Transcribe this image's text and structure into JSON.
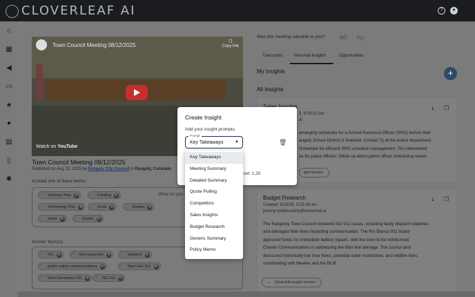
{
  "app": {
    "logo_text": "CLOVERLEAF AI"
  },
  "topbar": {
    "help_icon": "help-circle-icon",
    "account_icon": "account-circle-icon"
  },
  "sidebar": {
    "icons": [
      "home-icon",
      "dashboard-icon",
      "megaphone-icon",
      "chat-icon",
      "star-icon",
      "person-icon",
      "document-icon",
      "file-icon",
      "settings-shield-icon"
    ]
  },
  "video": {
    "overlay_title": "Town Council Meeting 08/12/2025",
    "copy_link": "Copy link",
    "watch_on": "Watch on",
    "youtube": "YouTube"
  },
  "meeting": {
    "title": "Town Council Meeting 08/12/2025",
    "published_prefix": "Published on Aug 13, 2025 by",
    "publisher": "Rangely City Council",
    "location_prefix": "in",
    "location": "Rangely, Colorado"
  },
  "terms": {
    "label": "At least one of these terms:",
    "search_placeholder": "What do you",
    "chips": [
      "Strategic Plan",
      "Funding",
      "Technology Plan",
      "funds",
      "Budget",
      "Grant",
      "Grants"
    ]
  },
  "anchor": {
    "label": "Anchor Term(s):",
    "chips": [
      "911",
      "first responder",
      "dispatch",
      "public safety communications",
      "Next Gen 911",
      "Next Generation 911",
      "NG 911"
    ]
  },
  "feedback": {
    "question": "Was this meeting valuable to you?"
  },
  "tabs": [
    "Transcripts",
    "Personal Insights",
    "Opportunities"
  ],
  "insights": {
    "my_heading": "My Insights",
    "all_heading": "All Insights",
    "add_label": "+",
    "cards": [
      {
        "title": "Sales Insights",
        "date": "3, 9:33:32 am",
        "author": "ai",
        "body_lines": [
          "arranging schedules for a School Resource Officer (SRO) before their",
          "angely School District is finalized. Contact Ty at the police department",
          "Scheduler for efficient SRO schedule management. Tim interviewed",
          "se for patrol officers; follow up about patrol officer scheduling needs."
        ],
        "show_label": "ight section"
      },
      {
        "title": "Budget Research",
        "date": "Created: 8/13/25, 5:05:38 am",
        "author": "jeremy+publicsafety@cloverleaf.ai",
        "body_lines": [
          "The Rangeley Town Council reviewed NG 911 issues, including faulty dispatch batteries",
          "and damaged fiber lines impacting communication. The Rio Blanco 911 board",
          "approved funds for immediate battery repairs, with the town to be reimbursed.",
          "Charter Communications is addressing the fiber line damage. The council also",
          "discussed historically low river flows, potential water restrictions, and wildfire risks,",
          "coordinating with Meeker and the BLM."
        ],
        "show_label": "Show full insight section"
      }
    ]
  },
  "modal": {
    "title": "Create Insight",
    "subtitle": "Add your insight prompts.",
    "prompt_label": "Prompt",
    "selected": "Key Takeaways",
    "credit": "dit Cost: 1.20",
    "options": [
      "Key Takeaways",
      "Meeting Summary",
      "Detailed Summary",
      "Quote Pulling",
      "Competitors",
      "Sales Insights",
      "Budget Research",
      "Generic Summary",
      "Policy Memo"
    ]
  },
  "colors": {
    "accent": "#2d4a6a",
    "topbar": "#1a1c20",
    "overlay": "#7b7b7b"
  }
}
